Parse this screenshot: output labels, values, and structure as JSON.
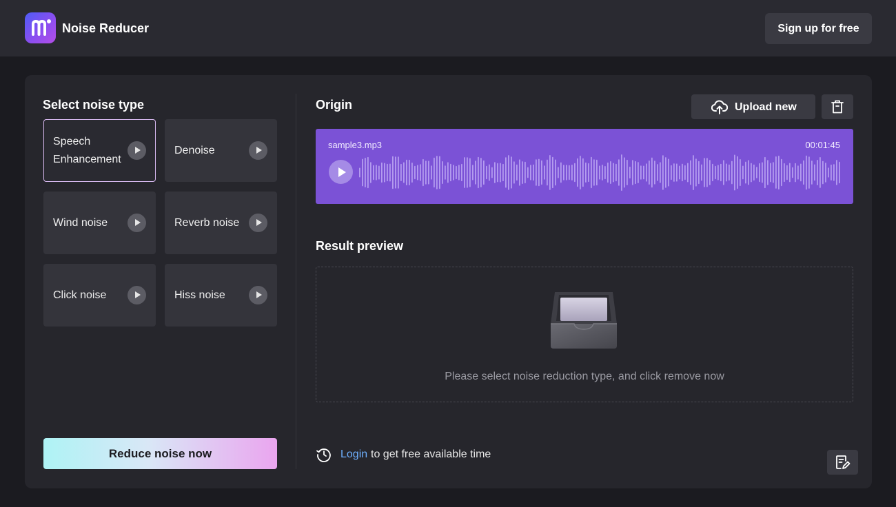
{
  "header": {
    "app_title": "Noise Reducer",
    "signup_label": "Sign up for free",
    "logo_icon": "modulate-logo-icon"
  },
  "noise_panel": {
    "title": "Select noise type",
    "options": [
      {
        "label": "Speech Enhancement",
        "selected": true
      },
      {
        "label": "Denoise",
        "selected": false
      },
      {
        "label": "Wind noise",
        "selected": false
      },
      {
        "label": "Reverb noise",
        "selected": false
      },
      {
        "label": "Click noise",
        "selected": false
      },
      {
        "label": "Hiss noise",
        "selected": false
      }
    ],
    "reduce_label": "Reduce noise now"
  },
  "origin": {
    "title": "Origin",
    "upload_label": "Upload new",
    "filename": "sample3.mp3",
    "duration": "00:01:45"
  },
  "result": {
    "title": "Result preview",
    "message": "Please select noise reduction type, and click remove now"
  },
  "footer": {
    "login_link": "Login",
    "login_text": "to get free available time"
  },
  "colors": {
    "accent": "#7b52d6",
    "background": "#1b1b20",
    "panel": "#26262c",
    "link": "#6eb0ff"
  }
}
